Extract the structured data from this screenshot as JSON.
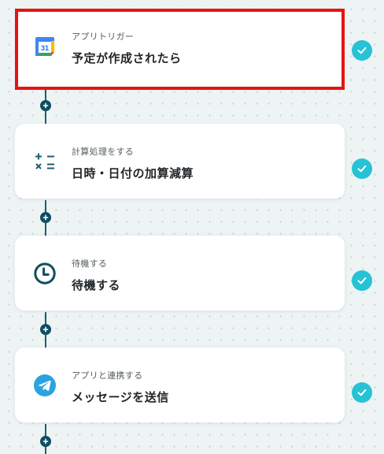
{
  "steps": [
    {
      "subtitle": "アプリトリガー",
      "title": "予定が作成されたら",
      "icon": "google-calendar-icon",
      "status": "completed",
      "selected": true
    },
    {
      "subtitle": "計算処理をする",
      "title": "日時・日付の加算減算",
      "icon": "calculator-icon",
      "status": "completed",
      "selected": false
    },
    {
      "subtitle": "待機する",
      "title": "待機する",
      "icon": "clock-icon",
      "status": "completed",
      "selected": false
    },
    {
      "subtitle": "アプリと連携する",
      "title": "メッセージを送信",
      "icon": "telegram-icon",
      "status": "completed",
      "selected": false
    }
  ],
  "colors": {
    "selection_border": "#e5140f",
    "connector": "#0e4e60",
    "check": "#27c2d6",
    "calendar_number": "31"
  }
}
